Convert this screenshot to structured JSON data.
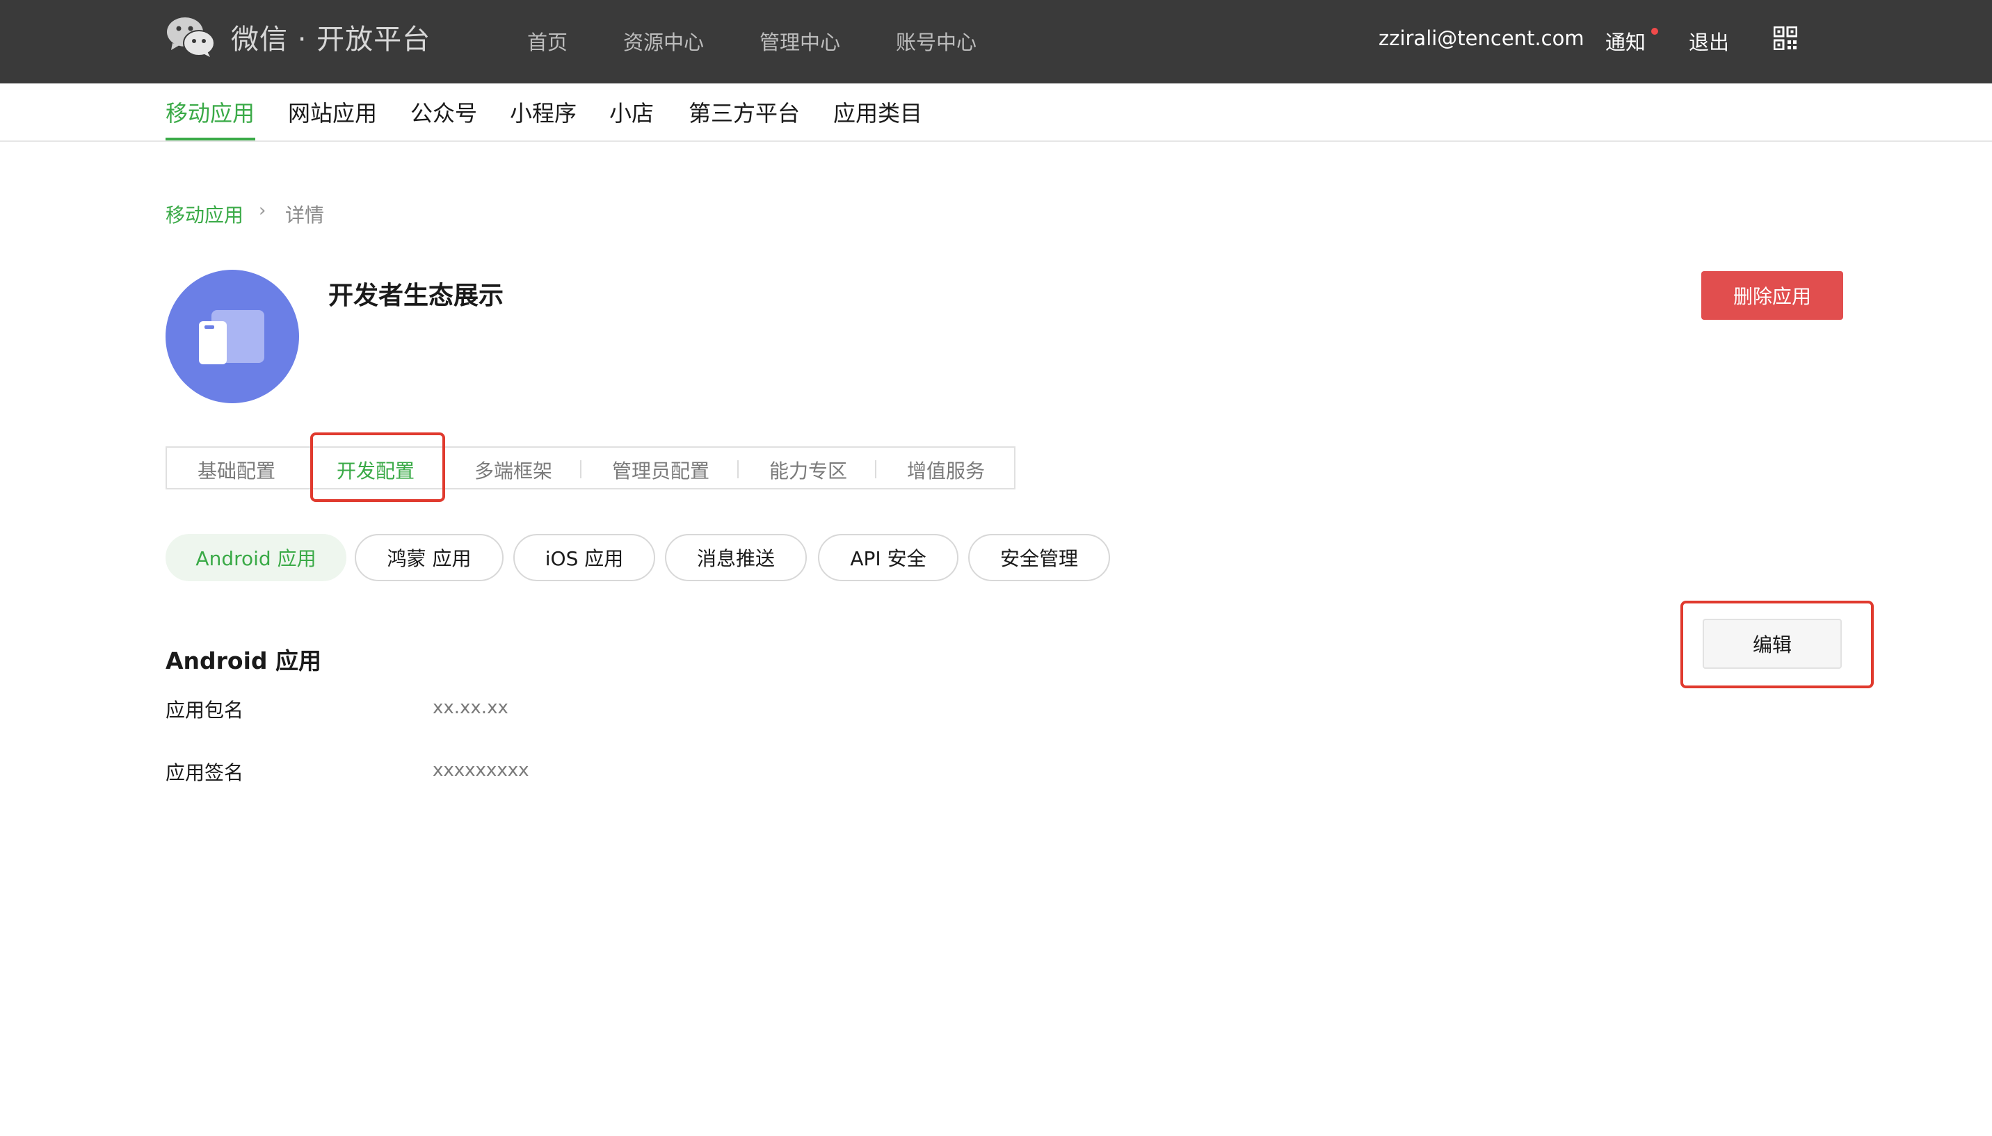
{
  "brand": {
    "title": "微信 · 开放平台",
    "icon": "wechat-logo-icon"
  },
  "top_nav": [
    "首页",
    "资源中心",
    "管理中心",
    "账号中心"
  ],
  "user": {
    "email": "zzirali@tencent.com",
    "notify": "通知",
    "logout": "退出",
    "qr_icon": "qrcode-icon"
  },
  "categories": [
    "移动应用",
    "网站应用",
    "公众号",
    "小程序",
    "小店",
    "第三方平台",
    "应用类目"
  ],
  "active_category": "移动应用",
  "breadcrumb": {
    "root": "移动应用",
    "separator": "›",
    "current": "详情"
  },
  "app": {
    "name": "开发者生态展示",
    "delete_label": "删除应用",
    "avatar_icon": "app-window-icon"
  },
  "tabs": [
    "基础配置",
    "开发配置",
    "多端框架",
    "管理员配置",
    "能力专区",
    "增值服务"
  ],
  "active_tab": "开发配置",
  "platforms": [
    "Android 应用",
    "鸿蒙 应用",
    "iOS 应用",
    "消息推送",
    "API 安全",
    "安全管理"
  ],
  "active_platform": "Android 应用",
  "section": {
    "title": "Android 应用",
    "edit_label": "编辑",
    "fields": [
      {
        "label": "应用包名",
        "value": "xx.xx.xx"
      },
      {
        "label": "应用签名",
        "value": "xxxxxxxxx"
      }
    ]
  },
  "colors": {
    "accent_green": "#3aaa47",
    "danger_red": "#e14e4e",
    "highlight_red": "#e03a2e",
    "topbar": "#3a3a3a",
    "avatar_blue": "#6b7fe6"
  }
}
